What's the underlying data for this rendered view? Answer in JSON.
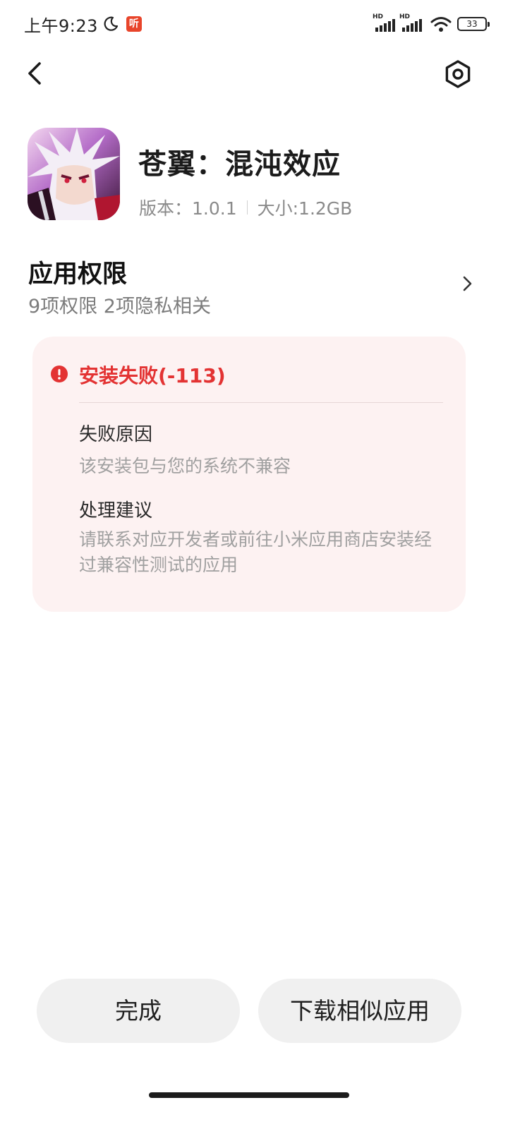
{
  "status_bar": {
    "time": "上午9:23",
    "listen_badge": "听",
    "signal_1_label": "HD",
    "signal_2_label": "HD",
    "battery": "33"
  },
  "app": {
    "name": "苍翼：混沌效应",
    "version": "版本：1.0.1",
    "size": "大小:1.2GB"
  },
  "permissions": {
    "title": "应用权限",
    "summary": "9项权限 2项隐私相关"
  },
  "error": {
    "title": "安装失败(-113)",
    "reason_label": "失败原因",
    "reason_text": "该安装包与您的系统不兼容",
    "advice_label": "处理建议",
    "advice_text": "请联系对应开发者或前往小米应用商店安装经过兼容性测试的应用",
    "color": "#e33333"
  },
  "buttons": {
    "done": "完成",
    "download_similar": "下载相似应用"
  },
  "icons": [
    "moon-icon",
    "signal-icon",
    "wifi-icon",
    "battery-icon",
    "back-arrow-icon",
    "settings-icon",
    "chevron-right-icon",
    "error-alert-icon"
  ]
}
